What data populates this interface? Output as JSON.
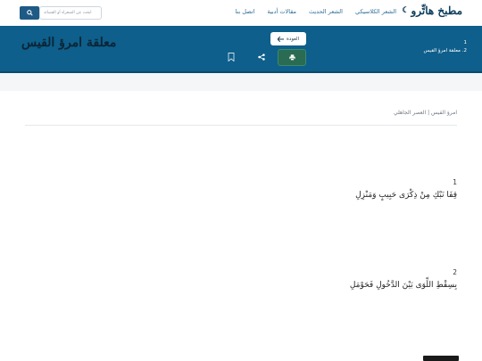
{
  "navbar": {
    "brand": "مطبخ هاتِّرو",
    "links": [
      "الشعر الكلاسيكي",
      "الشعر الحديث",
      "مقالات أدبية",
      "اتصل بنا"
    ],
    "search_placeholder": "ابحث عن الشعراء أو القصائد"
  },
  "header": {
    "back_label": "العودة",
    "title": "معلقة امرؤ القيس",
    "toc": [
      "1",
      "2. معلقة امرؤ القيس"
    ]
  },
  "poem": {
    "meta": "امرؤ القيس | العصر الجاهلي",
    "verses": [
      {
        "number": "1",
        "text": "قِفَا نَبْكِ مِنْ ذِكْرَى حَبِيبٍ وَمَنْزِلِ"
      },
      {
        "number": "2",
        "text": "بِسِقْطِ اللِّوَى بَيْنَ الدَّخُولِ فَحَوْمَلِ"
      }
    ]
  },
  "colors": {
    "header_bg": "#0e5f8b",
    "print_button": "#2a6b53",
    "brand": "#10405e"
  },
  "icons": [
    "moon-icon",
    "search-icon",
    "arrow-left-icon",
    "print-icon",
    "share-icon",
    "bookmark-icon"
  ]
}
